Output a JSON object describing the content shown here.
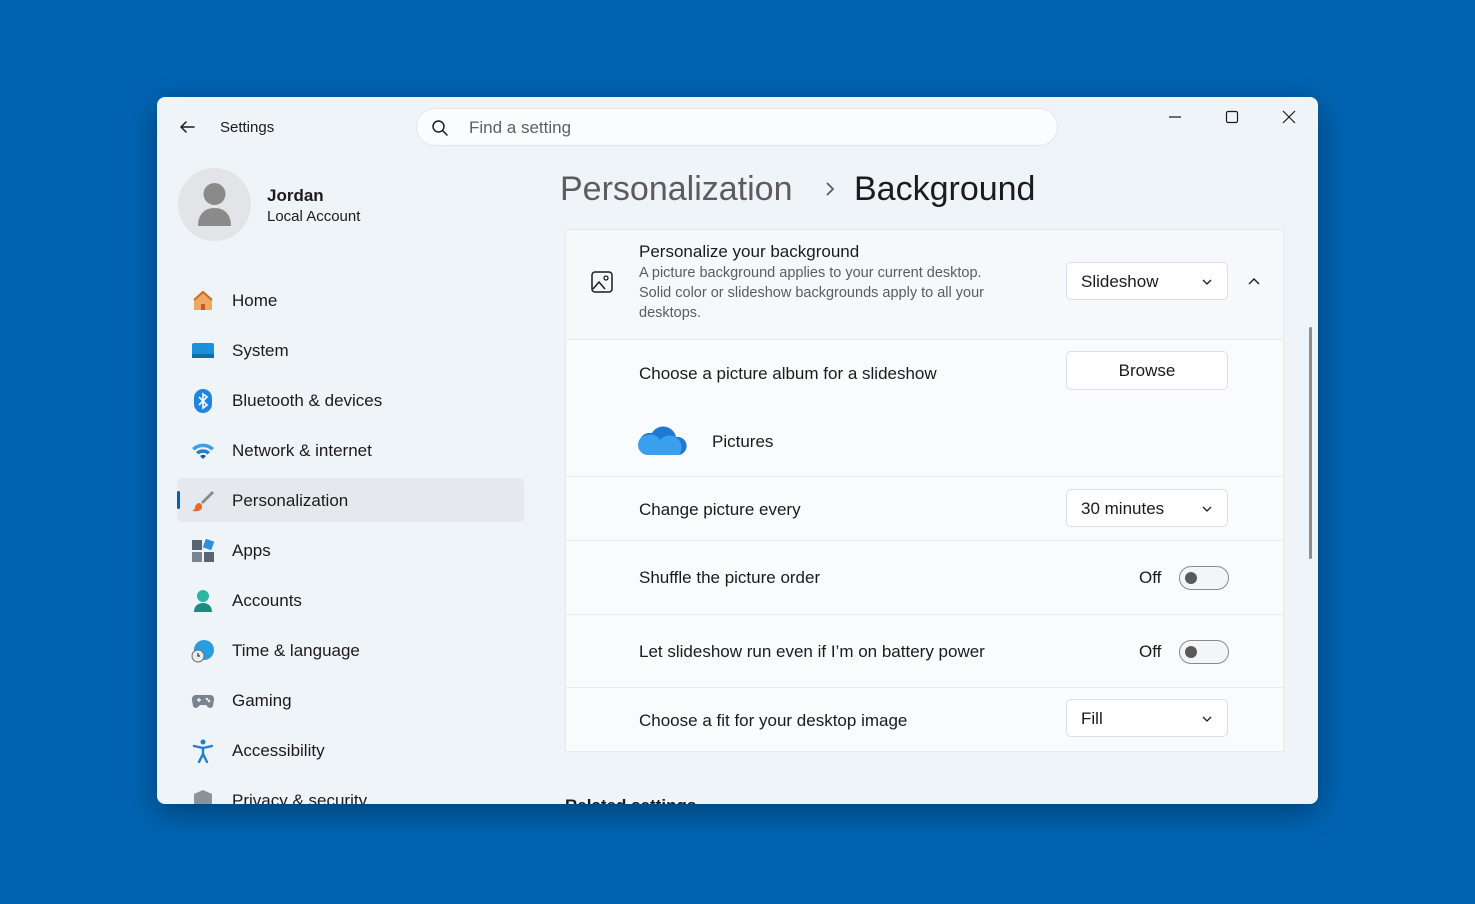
{
  "window": {
    "title": "Settings"
  },
  "search": {
    "placeholder": "Find a setting"
  },
  "user": {
    "name": "Jordan",
    "account_type": "Local Account"
  },
  "sidebar": {
    "items": [
      {
        "label": "Home",
        "icon": "home-icon"
      },
      {
        "label": "System",
        "icon": "system-icon"
      },
      {
        "label": "Bluetooth & devices",
        "icon": "bluetooth-icon"
      },
      {
        "label": "Network & internet",
        "icon": "wifi-icon"
      },
      {
        "label": "Personalization",
        "icon": "brush-icon",
        "active": true
      },
      {
        "label": "Apps",
        "icon": "apps-icon"
      },
      {
        "label": "Accounts",
        "icon": "accounts-icon"
      },
      {
        "label": "Time & language",
        "icon": "globe-clock-icon"
      },
      {
        "label": "Gaming",
        "icon": "gamepad-icon"
      },
      {
        "label": "Accessibility",
        "icon": "accessibility-icon"
      },
      {
        "label": "Privacy & security",
        "icon": "shield-icon"
      }
    ]
  },
  "breadcrumb": {
    "parent": "Personalization",
    "current": "Background"
  },
  "background": {
    "title": "Personalize your background",
    "description_line1": "A picture background applies to your current desktop.",
    "description_line2": "Solid color or slideshow backgrounds apply to all your",
    "description_line3": "desktops.",
    "type_value": "Slideshow",
    "album_label": "Choose a picture album for a slideshow",
    "browse_label": "Browse",
    "album_name": "Pictures",
    "interval_label": "Change picture every",
    "interval_value": "30 minutes",
    "shuffle_label": "Shuffle the picture order",
    "shuffle_state": "Off",
    "battery_label": "Let slideshow run even if I’m on battery power",
    "battery_state": "Off",
    "fit_label": "Choose a fit for your desktop image",
    "fit_value": "Fill"
  },
  "related": {
    "heading": "Related settings"
  },
  "colors": {
    "desktop": "#0063b1",
    "accent": "#005fb8",
    "window_bg": "#eff4f9"
  }
}
